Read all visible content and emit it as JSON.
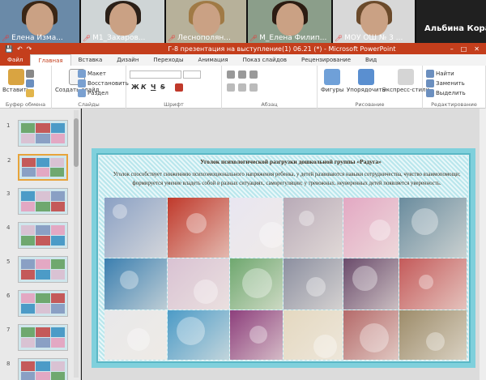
{
  "call": {
    "participants": [
      {
        "name": "Елена Изма...",
        "bg": "#6a8aa8",
        "hair": "#3a2616"
      },
      {
        "name": "М1_Захаров...",
        "bg": "#cfd5d6",
        "hair": "#2b2018"
      },
      {
        "name": "Леснополян...",
        "bg": "#b7b19a",
        "hair": "#a07a45"
      },
      {
        "name": "М_Елена Филип...",
        "bg": "#8b9e8a",
        "hair": "#2c1c12"
      },
      {
        "name": "МОУ ОШ № 3 ...",
        "bg": "#d8d8d8",
        "hair": "#6b4a2b"
      },
      {
        "name": "",
        "bg": "#c9b79e",
        "hair": "#5a3b22"
      }
    ],
    "speaker": "Альбина Кораб..."
  },
  "window": {
    "title": "Г-8 презентация на выступление(1) 06.21 (*) - Microsoft PowerPoint",
    "qat": [
      "💾",
      "↶",
      "↷"
    ],
    "winbtns": [
      "–",
      "□",
      "✕"
    ]
  },
  "ribbon_tabs": [
    "Файл",
    "Главная",
    "Вставка",
    "Дизайн",
    "Переходы",
    "Анимация",
    "Показ слайдов",
    "Рецензирование",
    "Вид"
  ],
  "ribbon": {
    "groups": [
      {
        "name": "Буфер обмена",
        "big": "Вставить",
        "small": [
          "Вырезать",
          "Копировать",
          "Формат"
        ]
      },
      {
        "name": "Слайды",
        "big": "Создать слайд",
        "small": [
          "Макет",
          "Восстановить",
          "Раздел"
        ]
      },
      {
        "name": "Шрифт",
        "bold": "Ж",
        "italic": "К",
        "underline": "Ч",
        "strike": "S"
      },
      {
        "name": "Абзац"
      },
      {
        "name": "Рисование",
        "big": [
          "Фигуры",
          "Упорядочить",
          "Экспресс-стили"
        ]
      },
      {
        "name": "Редактирование",
        "small": [
          "Найти",
          "Заменить",
          "Выделить"
        ]
      }
    ]
  },
  "thumbnails": [
    {
      "num": "1"
    },
    {
      "num": "2"
    },
    {
      "num": "3"
    },
    {
      "num": "4"
    },
    {
      "num": "5"
    },
    {
      "num": "6"
    },
    {
      "num": "7"
    },
    {
      "num": "8"
    }
  ],
  "slide": {
    "title": "Уголок психологической разгрузки дошкольной группы «Радуга»",
    "text": "Уголок способствует сниженнию психоэмоционального напряжения ребенка, у детей развиваются навыки сотрудничества, чувство взаимопомощи; формируется умение владеть собой в разных ситуациях, саморегуляции; у тревожных, неуверенных детей появляется уверенность.",
    "photo_palette": [
      [
        "#8aa0c4",
        "#c0392b",
        "#e9e6f1",
        "#b8aab7",
        "#e3a8c3",
        "#6a8c9e"
      ],
      [
        "#3b7fb0",
        "#d9c2d3",
        "#6fa86f",
        "#8c8fa0",
        "#6a4b6b",
        "#c45a5a"
      ],
      [
        "#e8e8ea",
        "#4c9bc7",
        "#8d3f7c",
        "#e4d8c0",
        "#b56a6a",
        "#9d8c6a"
      ]
    ]
  }
}
